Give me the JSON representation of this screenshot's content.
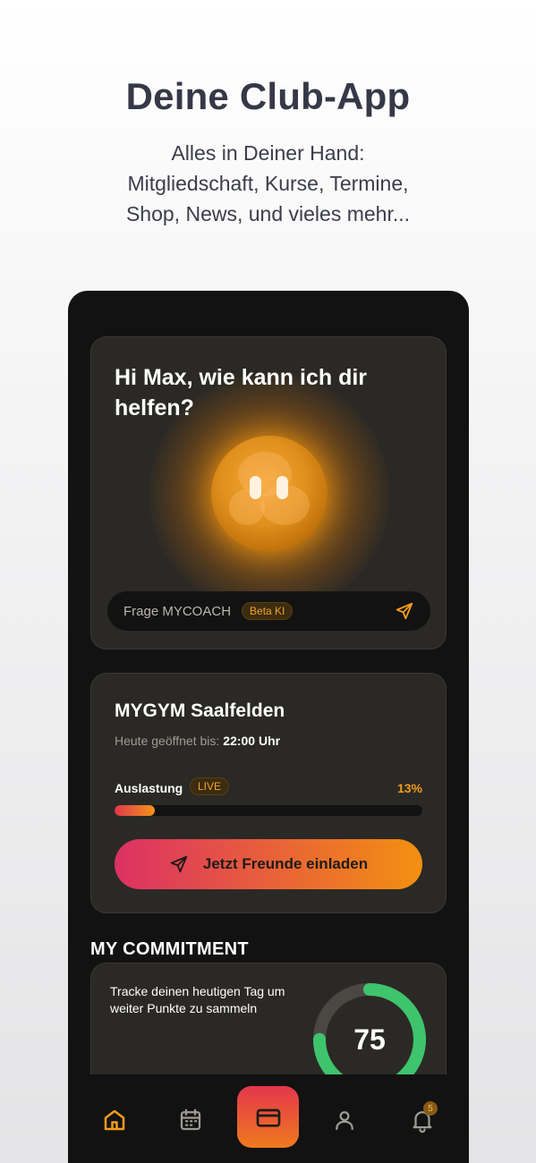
{
  "promo": {
    "title": "Deine Club-App",
    "subtitle_lines": [
      "Alles in Deiner Hand:",
      "Mitgliedschaft, Kurse, Termine,",
      "Shop, News, und vieles mehr..."
    ]
  },
  "coach": {
    "greeting": "Hi Max, wie kann ich dir helfen?",
    "input_placeholder": "Frage MYCOACH",
    "badge": "Beta KI"
  },
  "gym": {
    "name": "MYGYM Saalfelden",
    "hours_label": "Heute geöffnet bis:",
    "hours_value": "22:00 Uhr",
    "load_label": "Auslastung",
    "live_badge": "LIVE",
    "load_percent_text": "13%",
    "load_fraction": 0.13,
    "invite_label": "Jetzt Freunde einladen"
  },
  "commitment": {
    "section_title": "MY COMMITMENT",
    "text": "Tracke deinen heutigen Tag um weiter Punkte zu sammeln",
    "score": "75",
    "score_fraction": 0.75
  },
  "tabbar": {
    "items": [
      "home-icon",
      "calendar-icon",
      "card-icon",
      "profile-icon",
      "bell-icon"
    ],
    "notification_count": "5"
  },
  "colors": {
    "accent": "#f39c1c",
    "gradient_start": "#dc3064",
    "gradient_end": "#f39010",
    "ring_progress": "#3ec46d"
  }
}
